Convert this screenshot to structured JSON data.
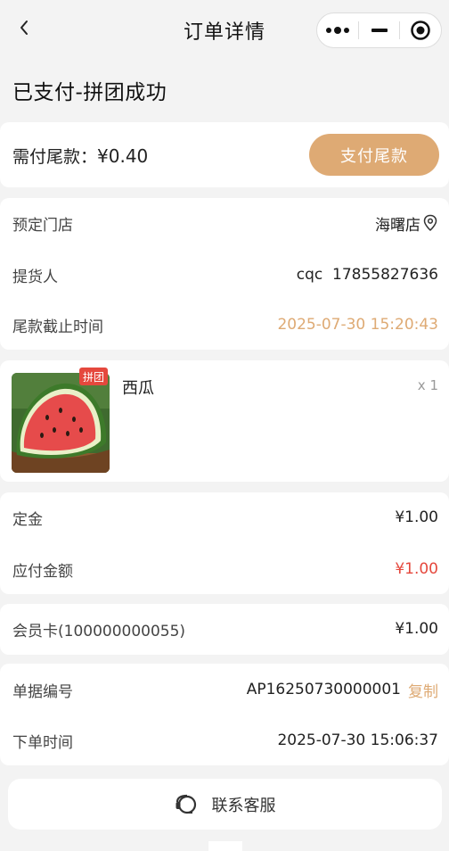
{
  "nav": {
    "title": "订单详情",
    "back_icon": "chevron-left-icon",
    "more_icon": "more-dots-icon",
    "minimize_icon": "minimize-icon",
    "close_icon": "record-circle-icon"
  },
  "status": "已支付-拼团成功",
  "payment": {
    "label": "需付尾款：",
    "amount": "¥0.40",
    "button": "支付尾款",
    "button_color": "#deaa74"
  },
  "store_info": {
    "rows": [
      {
        "label": "预定门店",
        "value": "海曙店",
        "icon": "location-pin-icon"
      },
      {
        "label": "提货人",
        "value": "cqc  17855827636"
      },
      {
        "label": "尾款截止时间",
        "value": "2025-07-30 15:20:43",
        "value_color": "#deaa74"
      }
    ]
  },
  "product": {
    "tag": "拼团",
    "name": "西瓜",
    "qty": "x 1",
    "image": "watermelon"
  },
  "prices": [
    {
      "label": "定金",
      "value": "¥1.00"
    },
    {
      "label": "应付金额",
      "value": "¥1.00",
      "value_color": "#e5483d"
    }
  ],
  "member": {
    "label": "会员卡(100000000055)",
    "value": "¥1.00"
  },
  "order": {
    "number_label": "单据编号",
    "number": "AP16250730000001",
    "copy": "复制",
    "time_label": "下单时间",
    "time": "2025-07-30 15:06:37"
  },
  "service": {
    "label": "联系客服",
    "icon": "headset-icon"
  },
  "colors": {
    "accent": "#deaa74",
    "red": "#e5483d",
    "background": "#f3f3f3"
  }
}
